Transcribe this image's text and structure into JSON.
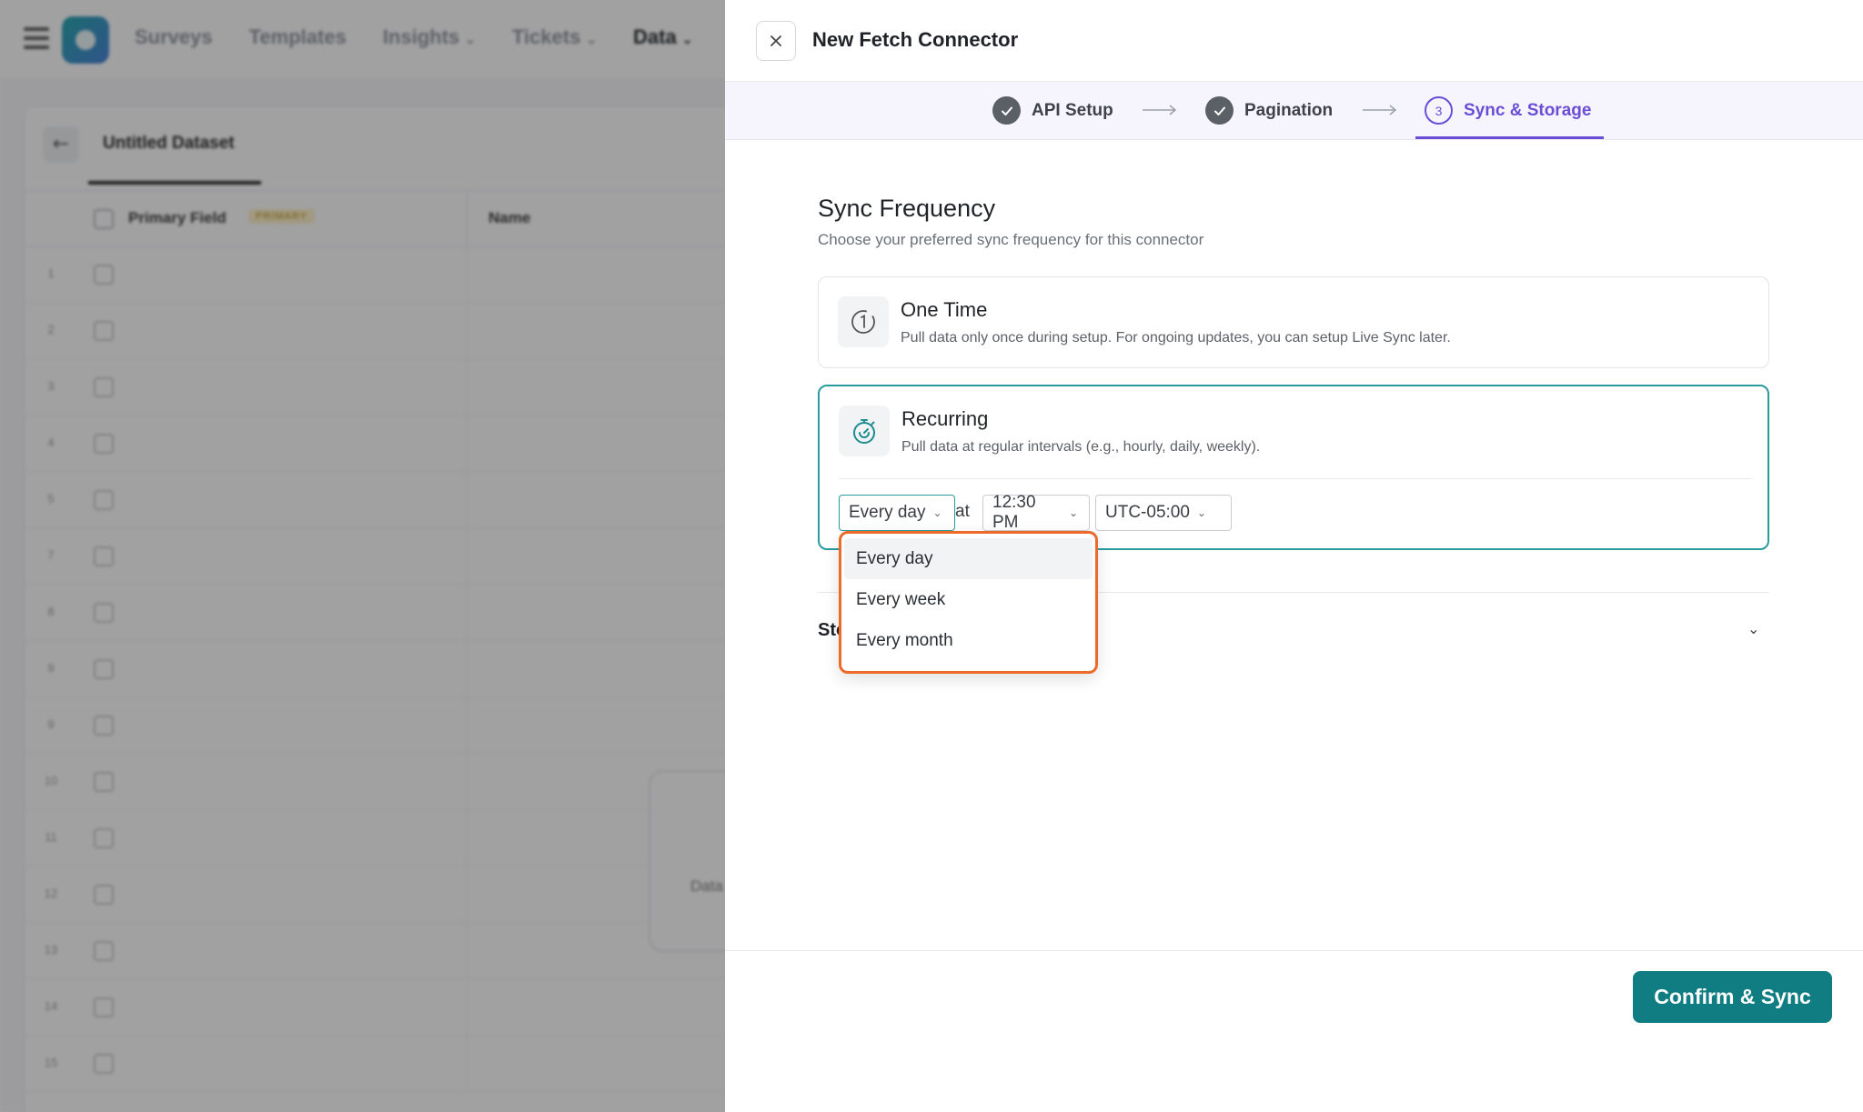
{
  "background": {
    "nav": {
      "items": [
        {
          "label": "Surveys",
          "caret": false,
          "strong": false
        },
        {
          "label": "Templates",
          "caret": false,
          "strong": false
        },
        {
          "label": "Insights",
          "caret": true,
          "strong": false
        },
        {
          "label": "Tickets",
          "caret": true,
          "strong": false
        },
        {
          "label": "Data",
          "caret": true,
          "strong": true
        }
      ]
    },
    "dataset": {
      "title": "Untitled Dataset",
      "columns": {
        "primary": "Primary Field",
        "primary_badge": "PRIMARY",
        "name": "Name"
      },
      "row_numbers": [
        "1",
        "2",
        "3",
        "4",
        "5",
        "7",
        "8",
        "9",
        "9",
        "10",
        "11",
        "12",
        "13",
        "14",
        "15"
      ],
      "empty_card_text": "Data fr"
    }
  },
  "drawer": {
    "title": "New Fetch Connector",
    "steps": [
      {
        "label": "API Setup",
        "state": "done"
      },
      {
        "label": "Pagination",
        "state": "done"
      },
      {
        "label": "Sync & Storage",
        "state": "active",
        "number": "3"
      }
    ],
    "sync": {
      "title": "Sync Frequency",
      "subtitle": "Choose your preferred sync frequency for this connector",
      "one_time": {
        "title": "One Time",
        "description": "Pull data only once during setup. For ongoing updates, you can setup Live Sync later.",
        "icon": "clock-one-icon"
      },
      "recurring": {
        "title": "Recurring",
        "description": "Pull data at regular intervals (e.g., hourly, daily, weekly).",
        "icon": "stopwatch-icon",
        "frequency_value": "Every day",
        "at_label": "at",
        "time_value": "12:30 PM",
        "timezone_value": "UTC-05:00"
      },
      "frequency_options": [
        "Every day",
        "Every week",
        "Every month"
      ],
      "selected_option": "Every day"
    },
    "storage": {
      "label": "Sto"
    },
    "confirm_label": "Confirm & Sync"
  },
  "colors": {
    "accent": "#0f7d82",
    "step_active": "#6a4fd6",
    "dropdown_highlight": "#ec6a2c",
    "recurring_border": "#2a9a9d"
  }
}
